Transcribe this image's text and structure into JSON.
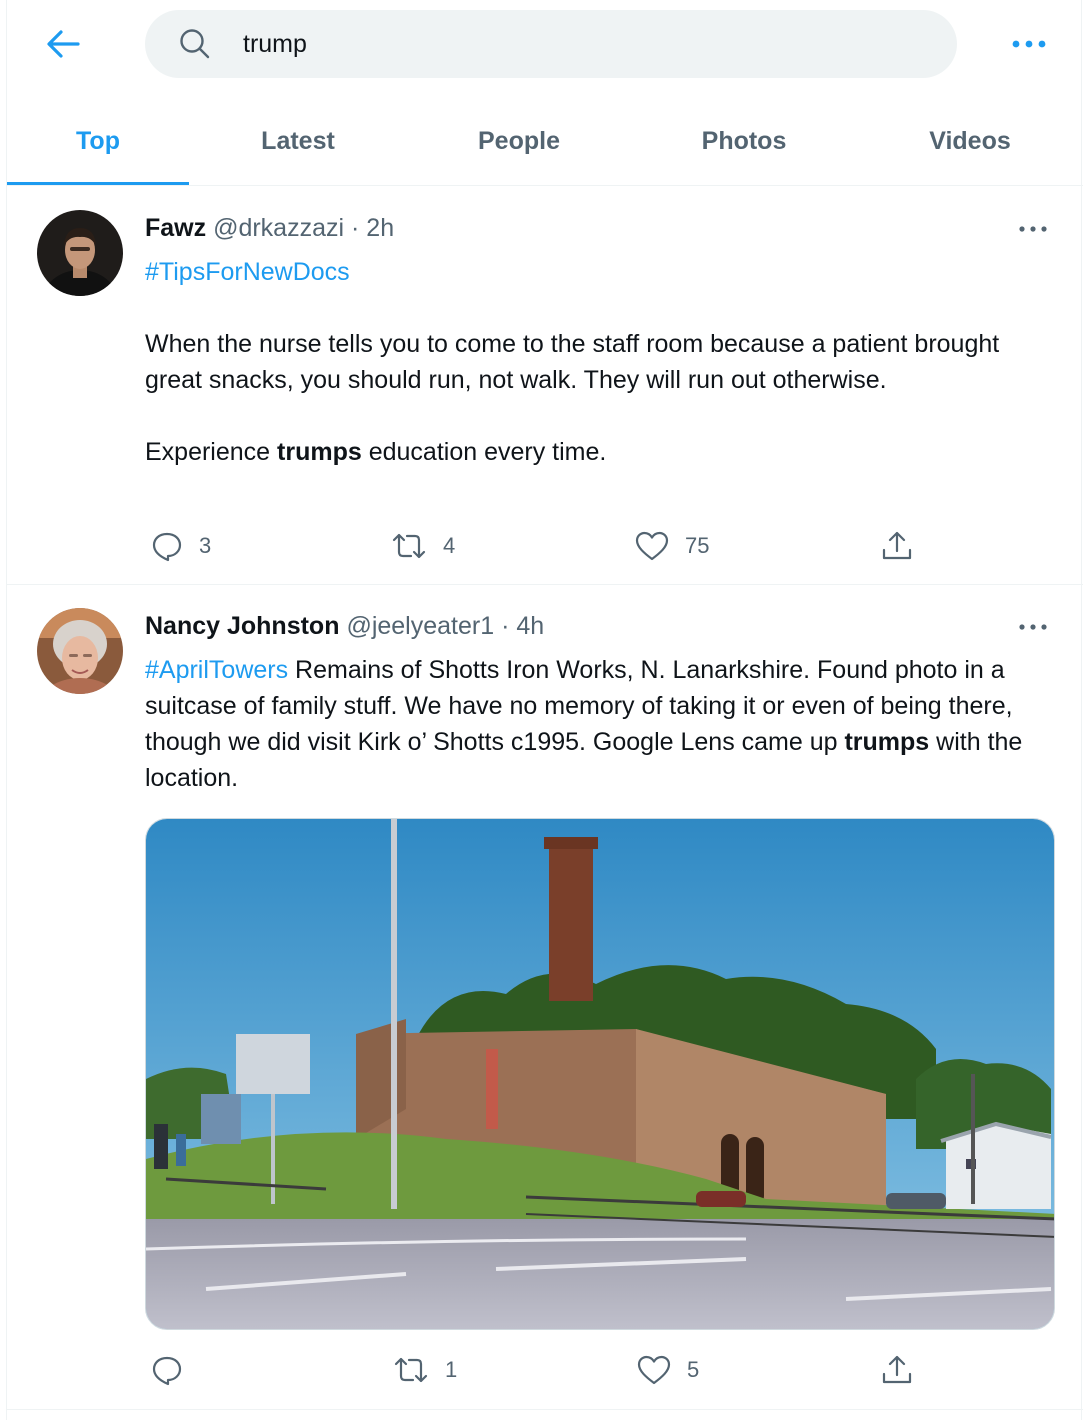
{
  "search": {
    "query": "trump"
  },
  "tabs": [
    {
      "label": "Top"
    },
    {
      "label": "Latest"
    },
    {
      "label": "People"
    },
    {
      "label": "Photos"
    },
    {
      "label": "Videos"
    }
  ],
  "tweets": [
    {
      "name": "Fawz",
      "handle": "@drkazzazi",
      "time": "2h",
      "hashtag": "#TipsForNewDocs",
      "para1": "When the nurse tells you to come to the staff room because a patient brought great snacks, you should run, not walk. They will run out otherwise.",
      "para2_pre": "Experience ",
      "para2_bold": "trumps",
      "para2_post": " education every time.",
      "replies": "3",
      "retweets": "4",
      "likes": "75"
    },
    {
      "name": "Nancy Johnston",
      "handle": "@jeelyeater1",
      "time": "4h",
      "hashtag": "#AprilTowers",
      "text_pre": " Remains of Shotts Iron Works, N. Lanarkshire. Found photo in a suitcase of family stuff. We have no memory of taking it or even of being there, though we did visit Kirk o’ Shotts  c1995.  Google Lens came up ",
      "text_bold": "trumps",
      "text_post": " with the location.",
      "replies": "",
      "retweets": "1",
      "likes": "5"
    }
  ],
  "colors": {
    "accent": "#1d9bf0",
    "secondary_text": "#536471",
    "divider": "#eff3f4"
  },
  "icons": [
    "back-arrow-icon",
    "search-icon",
    "more-icon",
    "reply-icon",
    "retweet-icon",
    "like-icon",
    "share-icon"
  ]
}
